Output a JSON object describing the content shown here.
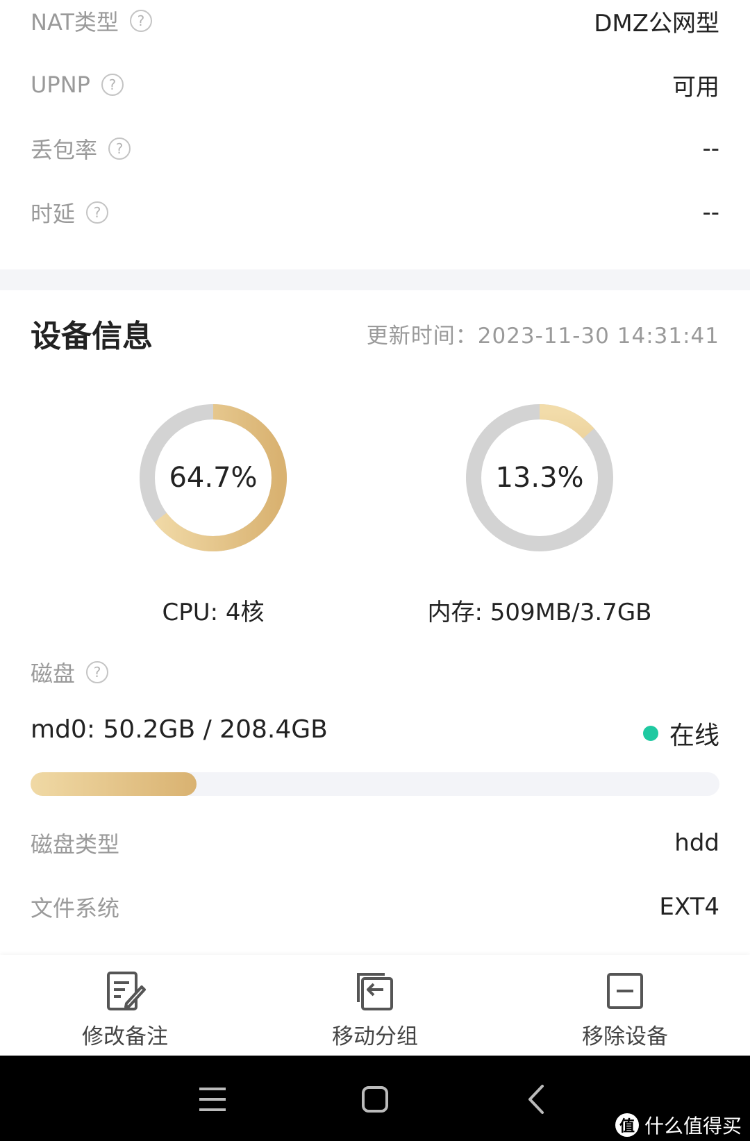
{
  "network": {
    "rows": [
      {
        "label": "NAT类型",
        "value": "DMZ公网型"
      },
      {
        "label": "UPNP",
        "value": "可用"
      },
      {
        "label": "丢包率",
        "value": "--"
      },
      {
        "label": "时延",
        "value": "--"
      }
    ],
    "help_glyph": "?"
  },
  "device": {
    "title": "设备信息",
    "update_time": "更新时间：2023-11-30 14:31:41",
    "cpu": {
      "percent_text": "64.7%",
      "percent": 64.7,
      "caption": "CPU: 4核"
    },
    "memory": {
      "percent_text": "13.3%",
      "percent": 13.3,
      "caption": "内存: 509MB/3.7GB"
    },
    "disk": {
      "section_label": "磁盘",
      "name": "md0: 50.2GB / 208.4GB",
      "used_fraction": 0.241,
      "status": "在线",
      "type_label": "磁盘类型",
      "type_value": "hdd",
      "fs_label": "文件系统",
      "fs_value": "EXT4"
    }
  },
  "actions": [
    {
      "label": "修改备注",
      "icon": "edit-note-icon"
    },
    {
      "label": "移动分组",
      "icon": "move-group-icon"
    },
    {
      "label": "移除设备",
      "icon": "remove-device-icon"
    }
  ],
  "watermark": {
    "glyph": "值",
    "text": "什么值得买"
  },
  "colors": {
    "accent_gold": "#d9b271",
    "track_gray": "#d3d3d3",
    "online_green": "#1fc9a1"
  }
}
